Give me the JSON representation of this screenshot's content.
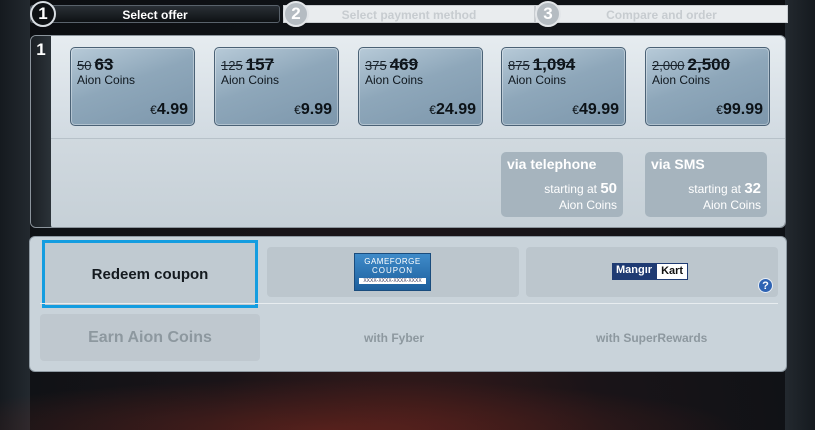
{
  "steps": [
    {
      "num": "1",
      "label": "Select offer"
    },
    {
      "num": "2",
      "label": "Select payment method"
    },
    {
      "num": "3",
      "label": "Compare and order"
    }
  ],
  "offer_panel": {
    "side_num": "1",
    "packages": [
      {
        "old": "50",
        "amount": "63",
        "currency": "Aion Coins",
        "price_symbol": "€",
        "price": "4.99"
      },
      {
        "old": "125",
        "amount": "157",
        "currency": "Aion Coins",
        "price_symbol": "€",
        "price": "9.99"
      },
      {
        "old": "375",
        "amount": "469",
        "currency": "Aion Coins",
        "price_symbol": "€",
        "price": "24.99"
      },
      {
        "old": "875",
        "amount": "1,094",
        "currency": "Aion Coins",
        "price_symbol": "€",
        "price": "49.99"
      },
      {
        "old": "2,000",
        "amount": "2,500",
        "currency": "Aion Coins",
        "price_symbol": "€",
        "price": "99.99"
      }
    ],
    "alternatives": [
      {
        "title": "via telephone",
        "starting": "starting at",
        "amount": "50",
        "currency": "Aion Coins"
      },
      {
        "title": "via SMS",
        "starting": "starting at",
        "amount": "32",
        "currency": "Aion Coins"
      }
    ]
  },
  "lower": {
    "redeem_label": "Redeem coupon",
    "earn_label": "Earn Aion Coins",
    "gameforge_logo": {
      "line1": "GAMEFORGE",
      "line2": "COUPON",
      "line3": "XXXX-XXXX-XXXX-XXXX"
    },
    "mangirkart_logo": {
      "part1": "Mangır",
      "part2": "Kart"
    },
    "help_label": "?",
    "with_fyber": "with Fyber",
    "with_superrewards": "with SuperRewards"
  },
  "colors": {
    "highlight": "#149de0",
    "step_active": "#0e1114",
    "step_inactive": "#e9ecee"
  },
  "icons": {
    "help": "question-circle-icon"
  }
}
